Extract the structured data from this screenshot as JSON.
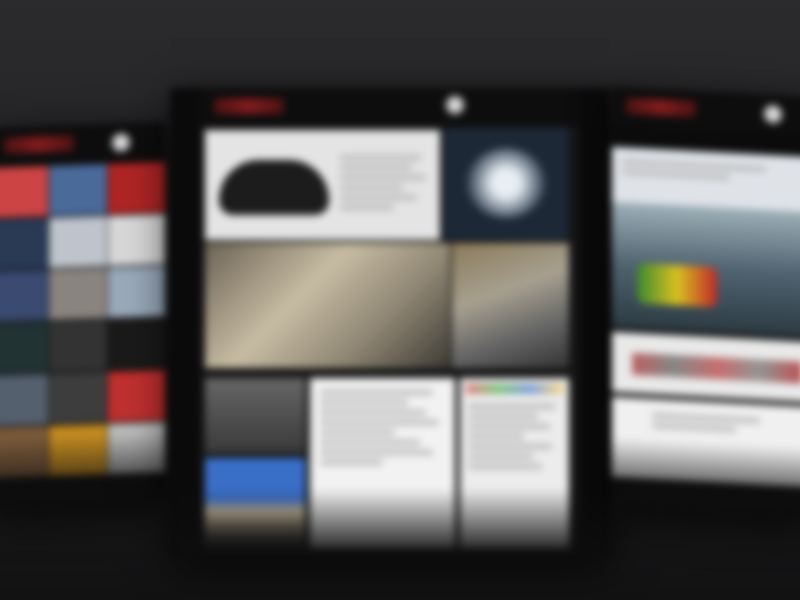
{
  "screen": {
    "background": "#222224",
    "accent": "#a02020"
  },
  "left_device": {
    "logo": "brand-logo",
    "menu_icon": "menu-icon",
    "cells": 18
  },
  "center_device": {
    "logo": "brand-logo",
    "menu_icon": "menu-icon",
    "tiles": [
      {
        "name": "featured-car-tile",
        "content": "car-photo"
      },
      {
        "name": "wheel-tile",
        "content": "wheel-photo"
      },
      {
        "name": "map-tile",
        "content": "map-photo"
      },
      {
        "name": "engine-tile",
        "content": "engine-photo"
      },
      {
        "name": "gray-photo-tile",
        "content": "photo"
      },
      {
        "name": "article-tile",
        "content": "text"
      },
      {
        "name": "sky-photo-tile",
        "content": "photo"
      },
      {
        "name": "text-column-tile",
        "content": "text"
      }
    ]
  },
  "right_device": {
    "logo": "brand-logo",
    "menu_icon": "menu-icon",
    "hero": "traffic-photo",
    "strip": "thumbnail-strip"
  }
}
